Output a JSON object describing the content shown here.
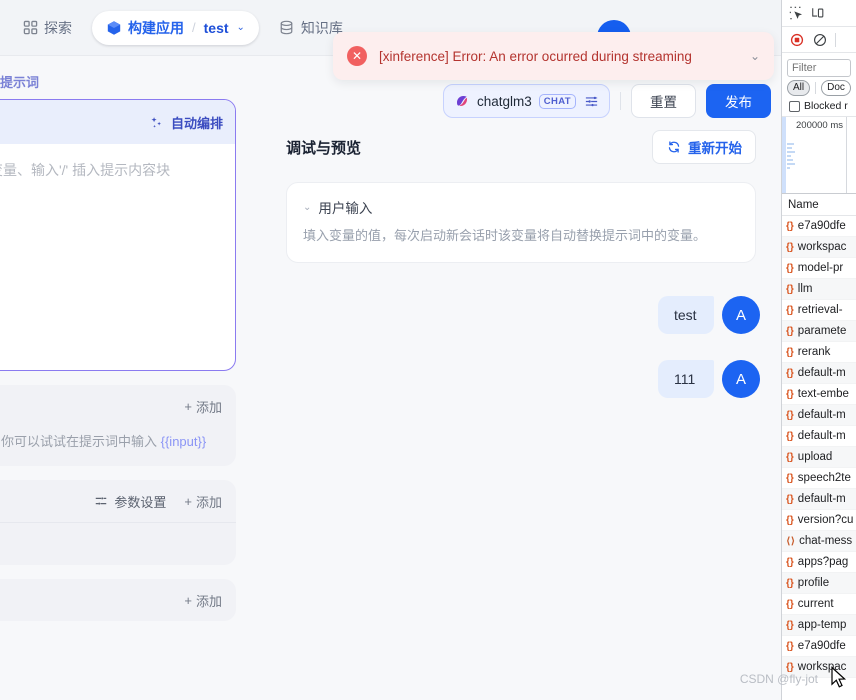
{
  "topnav": {
    "items": [
      {
        "label": "探索",
        "icon": "grid-icon"
      },
      {
        "label": "知识库",
        "icon": "database-icon"
      }
    ],
    "breadcrumb": {
      "app_label": "构建应用",
      "separator": "/",
      "name": "test",
      "caret": "⌄",
      "icon": "cube-icon"
    }
  },
  "toast": {
    "message": "[xinference] Error: An error ocurred during streaming",
    "icon": "error-circle-icon",
    "close_caret": "⌄"
  },
  "actionbar": {
    "model": {
      "name": "chatglm3",
      "badge": "CHAT",
      "logo": "chatglm-logo-icon",
      "settings_icon": "sliders-icon"
    },
    "reset_label": "重置",
    "publish_label": "发布"
  },
  "leftpanel": {
    "section_title": "提示词",
    "auto_arrange_label": "自动编排",
    "auto_arrange_icon": "sparkle-icon",
    "prompt_placeholder": "变量、输入'/' 插入提示内容块",
    "cards": [
      {
        "add_label": "添加",
        "hint_prefix": "，你可以试试在提示词中输入 ",
        "hint_var": "{{input}}"
      },
      {
        "param_label": "参数设置",
        "param_icon": "sliders-icon",
        "add_label": "添加"
      },
      {
        "add_label": "添加"
      }
    ]
  },
  "centerpanel": {
    "debug_title": "调试与预览",
    "restart_label": "重新开始",
    "restart_icon": "refresh-icon",
    "user_input": {
      "title": "用户输入",
      "caret": "⌄",
      "description": "填入变量的值，每次启动新会话时该变量将自动替换提示词中的变量。"
    },
    "messages": [
      {
        "text": "test",
        "avatar": "A"
      },
      {
        "text": "111",
        "avatar": "A"
      }
    ]
  },
  "devtools": {
    "toolbar_icons": [
      "inspect-element-icon",
      "device-toolbar-icon"
    ],
    "record_icon": "record-stop-icon",
    "clear_icon": "clear-icon",
    "filter_placeholder": "Filter",
    "filter_value": "",
    "pills": [
      {
        "label": "All",
        "selected": true
      },
      {
        "label": "Doc",
        "selected": false
      }
    ],
    "blocked_label": "Blocked r",
    "overview_time": "200000 ms",
    "column_header": "Name",
    "requests": [
      {
        "name": "e7a90dfe",
        "type": "json"
      },
      {
        "name": "workspac",
        "type": "json"
      },
      {
        "name": "model-pr",
        "type": "json"
      },
      {
        "name": "llm",
        "type": "json"
      },
      {
        "name": "retrieval-",
        "type": "json"
      },
      {
        "name": "paramete",
        "type": "json"
      },
      {
        "name": "rerank",
        "type": "json"
      },
      {
        "name": "default-m",
        "type": "json"
      },
      {
        "name": "text-embe",
        "type": "json"
      },
      {
        "name": "default-m",
        "type": "json"
      },
      {
        "name": "default-m",
        "type": "json"
      },
      {
        "name": "upload",
        "type": "json"
      },
      {
        "name": "speech2te",
        "type": "json"
      },
      {
        "name": "default-m",
        "type": "json"
      },
      {
        "name": "version?cu",
        "type": "json"
      },
      {
        "name": "chat-mess",
        "type": "doc"
      },
      {
        "name": "apps?pag",
        "type": "json"
      },
      {
        "name": "profile",
        "type": "json"
      },
      {
        "name": "current",
        "type": "json"
      },
      {
        "name": "app-temp",
        "type": "json"
      },
      {
        "name": "e7a90dfe",
        "type": "json"
      },
      {
        "name": "workspac",
        "type": "json"
      }
    ]
  },
  "watermark": "CSDN @fly-jot",
  "colors": {
    "brand_blue": "#1c64f2",
    "breadcrumb_blue": "#2563eb",
    "prompt_border": "#8b7bf0",
    "error_red": "#b4342f",
    "error_bg": "#fdeeee",
    "bubble_bg": "#e4edfd"
  }
}
